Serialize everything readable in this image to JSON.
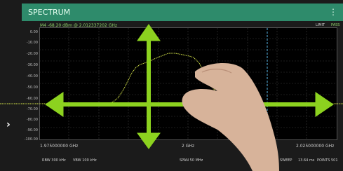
{
  "header": {
    "title": "SPECTRUM",
    "menu_icon": "more-vert-icon"
  },
  "marker": {
    "readout": "M4   -68.20  dBm  @  2.012337202 GHz"
  },
  "limit": {
    "label": "LIMIT",
    "status": "PASS"
  },
  "y_axis": {
    "labels": [
      "0.00",
      "-10.00",
      "-20.00",
      "-30.00",
      "-40.00",
      "-50.00",
      "-60.00",
      "-70.00",
      "-80.00",
      "-90.00",
      "-100.00"
    ]
  },
  "x_axis": {
    "start": "1.975000000 GHz",
    "center": "2 GHz",
    "stop": "2.025000000 GHz"
  },
  "bottom": {
    "rbw": "RBW 300 kHz",
    "vbw": "VBW 100 kHz",
    "span": "SPAN 50 MHz",
    "sweep_label": "SWEEP",
    "sweep_value": "13.64 ms",
    "points": "POINTS 501"
  },
  "sidebar": {
    "toggle_icon": "chevron-right-icon"
  },
  "colors": {
    "header": "#2e8b6b",
    "trace": "#d8e84a",
    "gesture": "#8cd21f"
  }
}
